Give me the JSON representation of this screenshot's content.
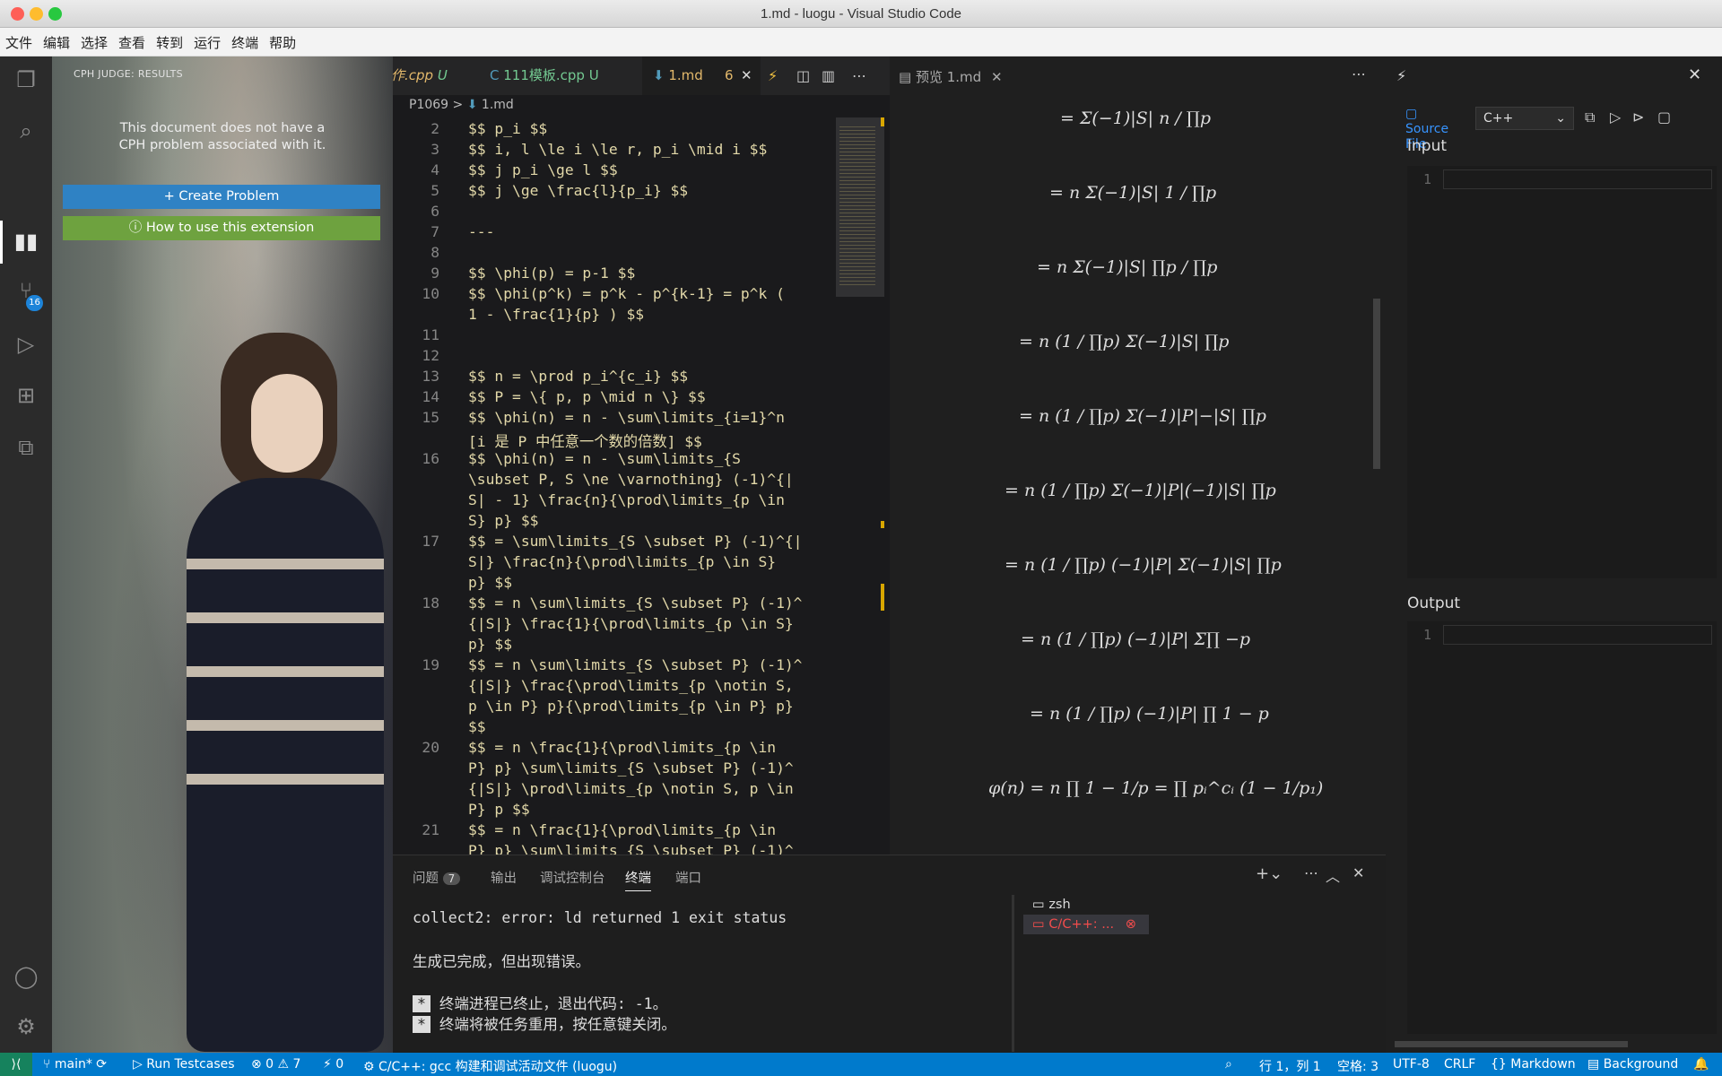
{
  "window": {
    "title": "1.md - luogu - Visual Studio Code"
  },
  "menu": [
    "文件",
    "编辑",
    "选择",
    "查看",
    "转到",
    "运行",
    "终端",
    "帮助"
  ],
  "activity": {
    "scm_badge": "16"
  },
  "sidebar": {
    "header": "CPH JUDGE: RESULTS",
    "message": "This document does not have a CPH problem associated with it.",
    "create_button": "+ Create Problem",
    "help_button": "ⓘ How to use this extension"
  },
  "tabs": [
    {
      "label": "作.cpp",
      "status": "U"
    },
    {
      "label": "111模板.cpp",
      "status": "U"
    },
    {
      "label": "1.md",
      "status": "6"
    }
  ],
  "breadcrumb": [
    "P1069",
    "1.md"
  ],
  "code_lines": [
    {
      "n": "2",
      "text": [
        "$$ p_i $$"
      ]
    },
    {
      "n": "3",
      "text": [
        "$$ i, l \\le i \\le r, p_i \\mid i $$"
      ]
    },
    {
      "n": "4",
      "text": [
        "$$ j p_i \\ge l $$"
      ]
    },
    {
      "n": "5",
      "text": [
        "$$ j \\ge \\frac{l}{p_i} $$"
      ]
    },
    {
      "n": "6",
      "text": [
        ""
      ]
    },
    {
      "n": "7",
      "text": [
        "---"
      ]
    },
    {
      "n": "8",
      "text": [
        ""
      ]
    },
    {
      "n": "9",
      "text": [
        "$$ \\phi(p) = p-1 $$"
      ]
    },
    {
      "n": "10",
      "text": [
        "$$ \\phi(p^k) = p^k - p^{k-1} = p^k (",
        "1 - \\frac{1}{p} ) $$"
      ]
    },
    {
      "n": "11",
      "text": [
        ""
      ]
    },
    {
      "n": "12",
      "text": [
        ""
      ]
    },
    {
      "n": "13",
      "text": [
        "$$ n = \\prod p_i^{c_i} $$"
      ]
    },
    {
      "n": "14",
      "text": [
        "$$ P = \\{ p, p \\mid n \\} $$"
      ]
    },
    {
      "n": "15",
      "text": [
        "$$ \\phi(n) = n - \\sum\\limits_{i=1}^n",
        "[i 是 P 中任意一个数的倍数] $$"
      ]
    },
    {
      "n": "16",
      "text": [
        "$$ \\phi(n) = n - \\sum\\limits_{S",
        "\\subset P, S \\ne \\varnothing} (-1)^{|",
        "S| - 1} \\frac{n}{\\prod\\limits_{p \\in",
        "S} p} $$"
      ]
    },
    {
      "n": "17",
      "text": [
        "$$ = \\sum\\limits_{S \\subset P} (-1)^{|",
        "S|} \\frac{n}{\\prod\\limits_{p \\in S}",
        "p} $$"
      ]
    },
    {
      "n": "18",
      "text": [
        "$$ = n \\sum\\limits_{S \\subset P} (-1)^",
        "{|S|} \\frac{1}{\\prod\\limits_{p \\in S}",
        "p} $$"
      ]
    },
    {
      "n": "19",
      "text": [
        "$$ = n \\sum\\limits_{S \\subset P} (-1)^",
        "{|S|} \\frac{\\prod\\limits_{p \\notin S,",
        "p \\in P} p}{\\prod\\limits_{p \\in P} p}",
        "$$"
      ]
    },
    {
      "n": "20",
      "text": [
        "$$ = n \\frac{1}{\\prod\\limits_{p \\in",
        "P} p} \\sum\\limits_{S \\subset P} (-1)^",
        "{|S|} \\prod\\limits_{p \\notin S, p \\in",
        "P} p $$"
      ]
    },
    {
      "n": "21",
      "text": [
        "$$ = n \\frac{1}{\\prod\\limits_{p \\in",
        "P} p} \\sum\\limits_{S \\subset P} (-1)^"
      ]
    }
  ],
  "preview": {
    "tab": "预览 1.md",
    "equations": [
      "= Σ(−1)|S| n / ∏p",
      "= n Σ(−1)|S| 1 / ∏p",
      "= n Σ(−1)|S| ∏p / ∏p",
      "= n (1 / ∏p) Σ(−1)|S| ∏p",
      "= n (1 / ∏p) Σ(−1)|P|−|S| ∏p",
      "= n (1 / ∏p) Σ(−1)|P|(−1)|S| ∏p",
      "= n (1 / ∏p) (−1)|P| Σ(−1)|S| ∏p",
      "= n (1 / ∏p) (−1)|P| Σ∏ −p",
      "= n (1 / ∏p) (−1)|P| ∏ 1 − p",
      "φ(n) = n ∏ 1 − 1/p = ∏ pᵢ^cᵢ (1 − 1/p₁)"
    ]
  },
  "cph_panel": {
    "source_label": "Source File",
    "language": "C++",
    "input_label": "Input",
    "output_label": "Output",
    "input_line": "1",
    "output_line": "1"
  },
  "bottom_panel": {
    "tabs": [
      "问题",
      "输出",
      "调试控制台",
      "终端",
      "端口"
    ],
    "problems_count": "7",
    "terminal_lines": [
      "collect2: error: ld returned 1 exit status",
      "生成已完成，但出现错误。",
      "终端进程已终止，退出代码: -1。",
      "终端将被任务重用，按任意键关闭。"
    ],
    "terminals": [
      "zsh",
      "C/C++: ..."
    ]
  },
  "status": {
    "branch": "main*",
    "run": "Run Testcases",
    "problems": "⊗ 0 ⚠ 7",
    "ports": "⚡ 0",
    "task": "C/C++: gcc 构建和调试活动文件 (luogu)",
    "cursor": "行 1，列 1",
    "spaces": "空格: 3",
    "encoding": "UTF-8",
    "eol": "CRLF",
    "language": "Markdown",
    "background": "Background"
  }
}
